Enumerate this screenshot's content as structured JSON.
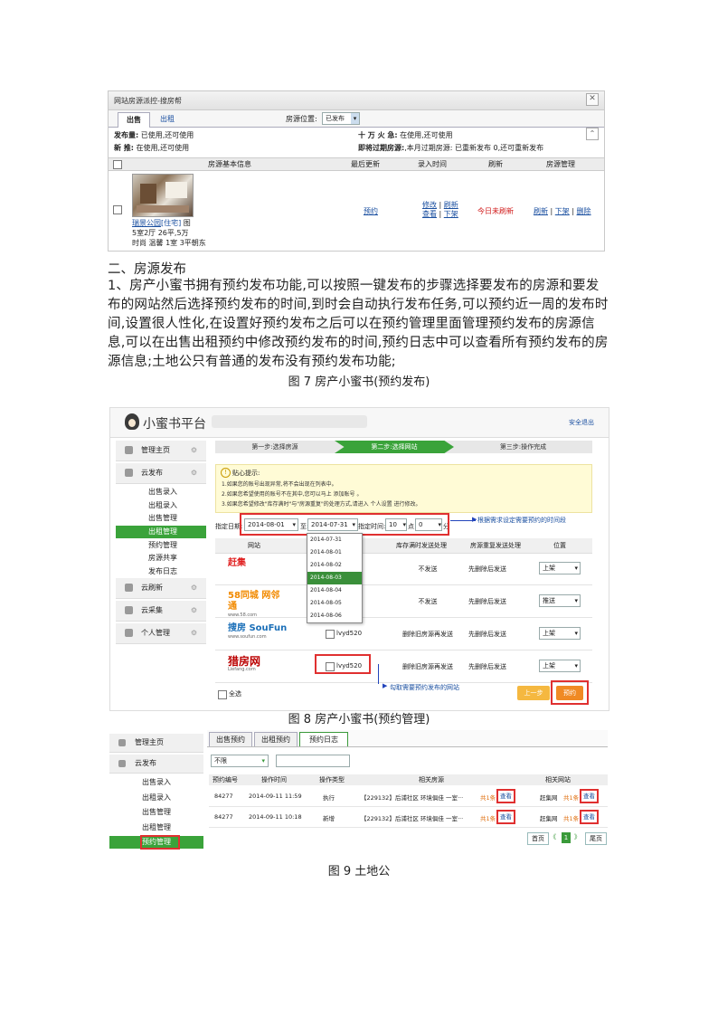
{
  "s1": {
    "window_title": "网站房源派控-搜房帮",
    "tabs": [
      "出售",
      "出租"
    ],
    "position_label": "房源位置:",
    "position_value": "已发布",
    "quota1_label": "发布量:",
    "quota1_value": "已使用,还可使用",
    "quota2_label": "十 万 火 急:",
    "quota2_value": "在使用,还可使用",
    "quota3_label": "新    推:",
    "quota3_value": "在使用,还可使用",
    "quota4_label": "即将过期房源:",
    "quota4_value": ",本月过期房源: 已重新发布 0,还可重新发布",
    "columns": [
      "房源基本信息",
      "最后更新",
      "录入时间",
      "刷新",
      "房源管理"
    ],
    "listing_title": "瑞景公园",
    "listing_type": "[住宅]",
    "listing_icon": "图",
    "listing_line2": "5室2厅 26平,5万",
    "listing_line3": "时尚 温馨 1室 3平朝东",
    "last_update": "预约",
    "entry_links": [
      "修改",
      "刷新",
      "查看",
      "下架"
    ],
    "refresh_status": "今日未刷新",
    "manage_links": [
      "刷新",
      "下架",
      "删除"
    ]
  },
  "section_title": "二、房源发布",
  "paragraph": "1、房产小蜜书拥有预约发布功能,可以按照一键发布的步骤选择要发布的房源和要发布的网站然后选择预约发布的时间,到时会自动执行发布任务,可以预约近一周的发布时间,设置很人性化,在设置好预约发布之后可以在预约管理里面管理预约发布的房源信息,可以在出售出租预约中修改预约发布的时间,预约日志中可以查看所有预约发布的房源信息;土地公只有普通的发布没有预约发布功能;",
  "caption7": "图 7 房产小蜜书(预约发布)",
  "s2": {
    "logo": "小蜜书平台",
    "logout": "安全退出",
    "steps": [
      "第一步:选择房源",
      "第二步:选择网站",
      "第三步:操作完成"
    ],
    "sidebar": [
      {
        "label": "管理主页",
        "type": "box"
      },
      {
        "label": "云发布",
        "type": "box"
      },
      {
        "label": "出售录入",
        "type": "sub"
      },
      {
        "label": "出租录入",
        "type": "sub"
      },
      {
        "label": "出售管理",
        "type": "sub"
      },
      {
        "label": "出租管理",
        "type": "active"
      },
      {
        "label": "预约管理",
        "type": "sub"
      },
      {
        "label": "房源共享",
        "type": "sub"
      },
      {
        "label": "发布日志",
        "type": "sub"
      },
      {
        "label": "云刷新",
        "type": "box"
      },
      {
        "label": "云采集",
        "type": "box"
      },
      {
        "label": "个人管理",
        "type": "box"
      }
    ],
    "tip_title": "贴心提示:",
    "tips": [
      "1.如果您的账号出现异常,将不会出现在列表中。",
      "2.如果您希望使用的账号不在其中,您可以马上 添加账号 。",
      "3.如果您希望修改\"库存满时\"与\"房源重复\"的处理方式,请进入 个人设置 进行修改。"
    ],
    "date_label": "指定日期:",
    "date_from": "2014-08-01",
    "date_to_label": "至:",
    "date_to": "2014-07-31",
    "time_label": "指定时间:",
    "hour": "10",
    "hour_unit": "点",
    "minute": "0",
    "minute_unit": "分",
    "annotation1": "根据需求设定需要预约的时间段",
    "dropdown_dates": [
      "2014-07-31",
      "2014-08-01",
      "2014-08-02",
      "2014-08-03",
      "2014-08-04",
      "2014-08-05",
      "2014-08-06"
    ],
    "table_headers": [
      "网站",
      "",
      "库存满时发送处理",
      "房源重复发送处理",
      "位置"
    ],
    "sites": [
      {
        "name": "赶集",
        "account": "",
        "stock": "不发送",
        "dup": "先删除后发送",
        "position": "上架"
      },
      {
        "name": "58同城 网邻通",
        "account": "",
        "stock": "不发送",
        "dup": "先删除后发送",
        "position": "推送"
      },
      {
        "name": "搜房 SouFun",
        "account": "lvyd520",
        "stock": "删除旧房源再发送",
        "dup": "先删除后发送",
        "position": "上架"
      },
      {
        "name": "猎房网",
        "account": "lvyd520",
        "stock": "删除旧房源再发送",
        "dup": "先删除后发送",
        "position": "上架"
      }
    ],
    "site_url_58": "www.58.com",
    "site_url_soufun": "www.soufun.com",
    "site_url_liefang": "Liefang.com",
    "select_all": "全选",
    "annotation2": "勾取需要预约发布的网站",
    "prev_btn": "上一步",
    "next_btn": "预约"
  },
  "caption8": "图 8 房产小蜜书(预约管理)",
  "s3": {
    "sidebar": [
      "管理主页",
      "云发布",
      "出售录入",
      "出租录入",
      "出售管理",
      "出租管理",
      "预约管理"
    ],
    "tabs": [
      "出售预约",
      "出租预约",
      "预约日志"
    ],
    "filter": "不限",
    "headers": [
      "预约编号",
      "操作时间",
      "操作类型",
      "相关房源",
      "相关网站"
    ],
    "rows": [
      {
        "id": "84277",
        "time": "2014-09-11 11:59",
        "type": "执行",
        "listing": "【229132】后浦社区 环境俱佳 一室···",
        "count": "共1条",
        "view": "查看",
        "site": "赶集网",
        "site_count": "共1条",
        "site_view": "查看"
      },
      {
        "id": "84277",
        "time": "2014-09-11 10:18",
        "type": "新增",
        "listing": "【229132】后浦社区 环境俱佳 一室···",
        "count": "共1条",
        "view": "查看",
        "site": "赶集网",
        "site_count": "共1条",
        "site_view": "查看"
      }
    ],
    "pager_first": "首页",
    "pager_prev": "《",
    "pager_current": "1",
    "pager_next": "》",
    "pager_last": "尾页"
  },
  "caption9": "图 9 土地公"
}
